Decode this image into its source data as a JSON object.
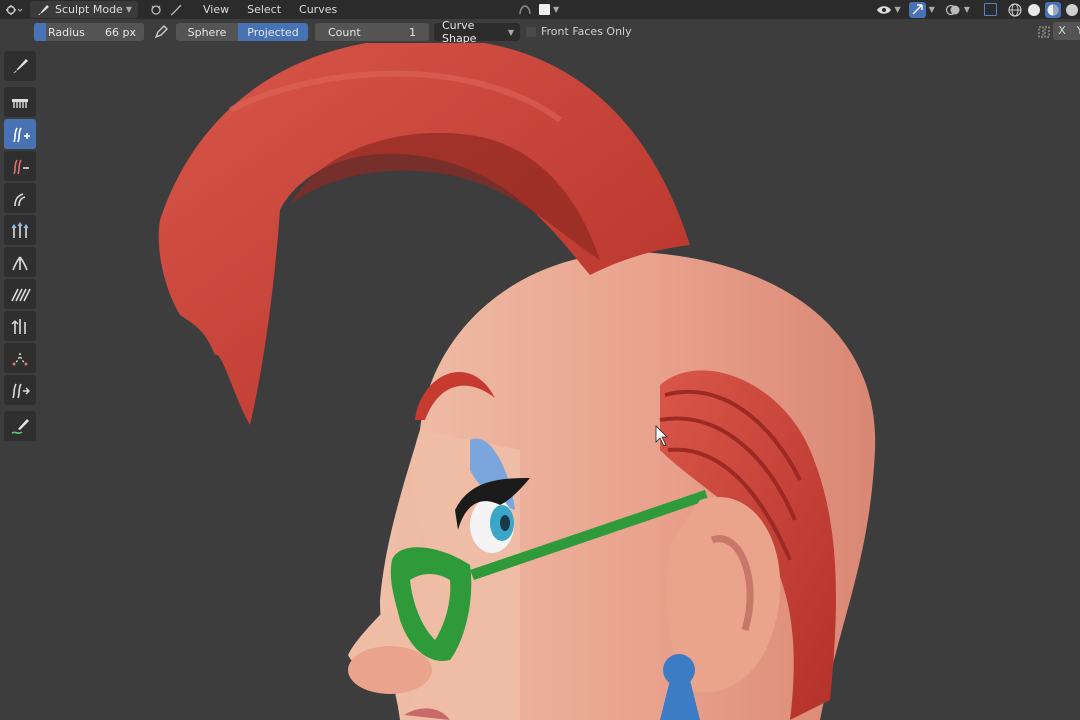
{
  "header": {
    "mode_label": "Sculpt Mode",
    "menus": [
      "View",
      "Select",
      "Curves"
    ]
  },
  "tool_header": {
    "radius_label": "Radius",
    "radius_value": "66 px",
    "falloff_options": [
      "Sphere",
      "Projected"
    ],
    "falloff_selected": "Projected",
    "count_label": "Count",
    "count_value": "1",
    "curve_shape_label": "Curve Shape",
    "front_faces_label": "Front Faces Only",
    "front_faces_checked": false,
    "axis_x": "X",
    "axis_y": "Y"
  },
  "toolbar": {
    "tools": [
      {
        "name": "selection-paint-icon",
        "active": false
      },
      {
        "name": "comb-icon",
        "active": false
      },
      {
        "name": "add-curves-icon",
        "active": true
      },
      {
        "name": "delete-curves-icon",
        "active": false
      },
      {
        "name": "snake-hook-icon",
        "active": false
      },
      {
        "name": "grow-shrink-icon",
        "active": false
      },
      {
        "name": "pinch-icon",
        "active": false
      },
      {
        "name": "puff-icon",
        "active": false
      },
      {
        "name": "smooth-icon",
        "active": false
      },
      {
        "name": "density-icon",
        "active": false
      },
      {
        "name": "slide-icon",
        "active": false
      },
      {
        "name": "annotate-icon",
        "active": false
      }
    ]
  },
  "colors": {
    "accent": "#4772b3",
    "header_bg": "#2b2b2b",
    "viewport_bg": "#3d3d3d",
    "hair": "#c6403a",
    "skin": "#e8a58f",
    "glasses": "#2f9a3a",
    "earring": "#3b7cc4"
  }
}
